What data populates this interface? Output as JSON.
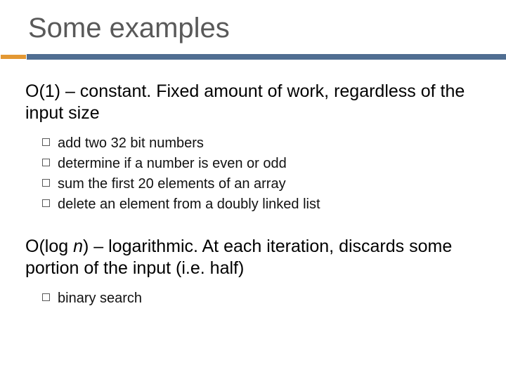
{
  "title": "Some examples",
  "sections": [
    {
      "lead": "O(1) – constant.  Fixed amount of work, regardless of the input size",
      "items": [
        "add two 32 bit numbers",
        "determine if a number is even or odd",
        "sum the first 20 elements of an array",
        "delete an element from a doubly linked list"
      ]
    },
    {
      "lead_prefix": "O(log ",
      "lead_italic": "n",
      "lead_suffix": ") – logarithmic.  At each iteration, discards some portion of the input (i.e. half)",
      "items": [
        "binary search"
      ]
    }
  ]
}
